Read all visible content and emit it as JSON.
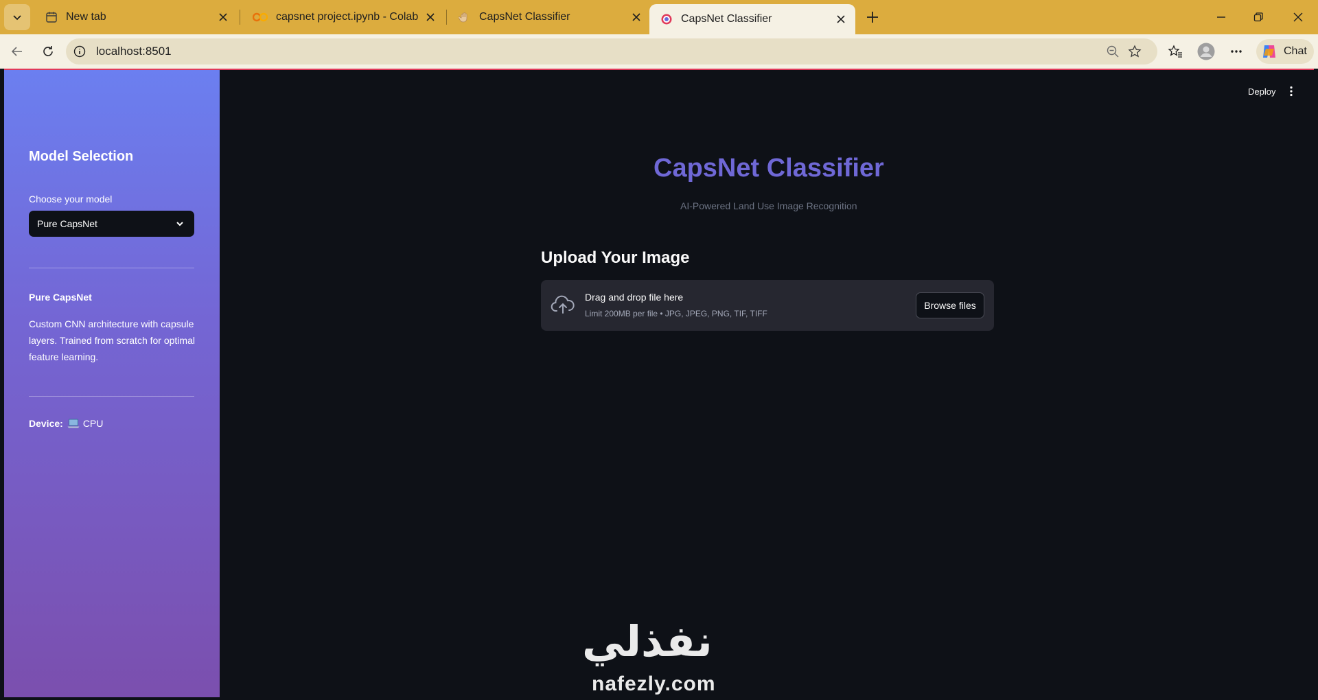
{
  "browser": {
    "tabs": [
      {
        "title": "New tab",
        "icon": "calendar-icon",
        "active": false
      },
      {
        "title": "capsnet project.ipynb - Colab",
        "icon": "colab-icon",
        "active": false
      },
      {
        "title": "CapsNet Classifier",
        "icon": "hand-icon",
        "active": false
      },
      {
        "title": "CapsNet Classifier",
        "icon": "target-icon",
        "active": true
      }
    ],
    "url": "localhost:8501",
    "chat_label": "Chat"
  },
  "toolbar": {
    "deploy_label": "Deploy"
  },
  "sidebar": {
    "heading": "Model Selection",
    "select_label": "Choose your model",
    "selected_model": "Pure CapsNet",
    "model_name": "Pure CapsNet",
    "model_description": "Custom CNN architecture with capsule layers. Trained from scratch for optimal feature learning.",
    "device_label": "Device:",
    "device_value": "CPU",
    "device_icon": "laptop-icon"
  },
  "main": {
    "title": "CapsNet Classifier",
    "subtitle": "AI-Powered Land Use Image Recognition",
    "upload_heading": "Upload Your Image",
    "dropzone_text": "Drag and drop file here",
    "dropzone_limit": "Limit 200MB per file • JPG, JPEG, PNG, TIF, TIFF",
    "browse_label": "Browse files"
  },
  "watermark": {
    "arabic": "نفذلي",
    "latin": "nafezly.com"
  },
  "colors": {
    "accent_title": "#6f68d6",
    "tabbar": "#dcac3e",
    "sidebar_top": "#6b7ff0",
    "sidebar_bottom": "#7b4fae",
    "app_bg": "#0e1117"
  }
}
